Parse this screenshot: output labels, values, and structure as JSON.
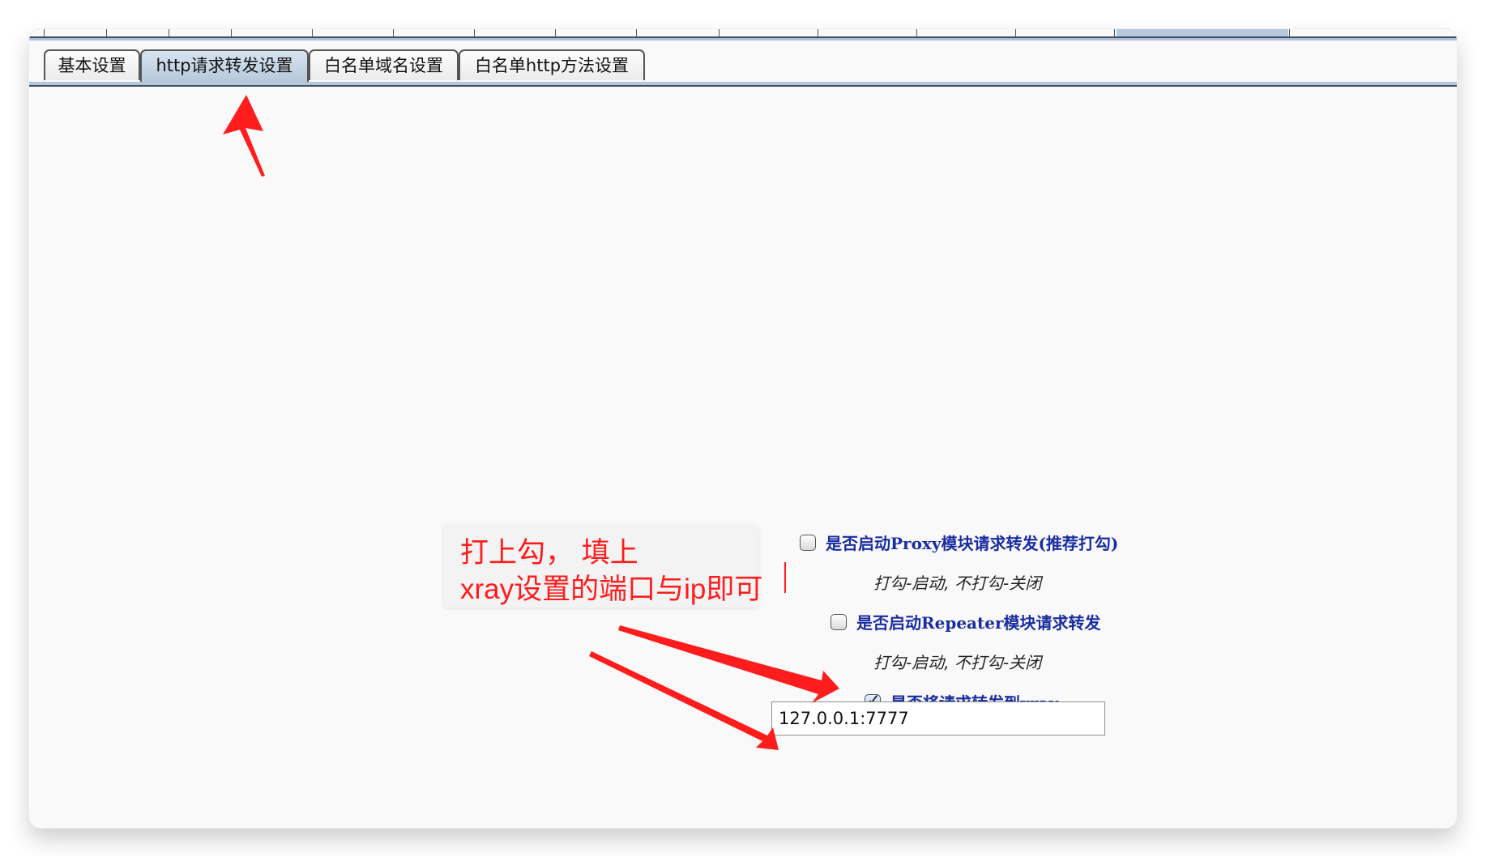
{
  "tabs": [
    {
      "label": "基本设置",
      "active": false
    },
    {
      "label": "http请求转发设置",
      "active": true
    },
    {
      "label": "白名单域名设置",
      "active": false
    },
    {
      "label": "白名单http方法设置",
      "active": false
    }
  ],
  "options": {
    "proxy": {
      "label": "是否启动Proxy模块请求转发(推荐打勾)",
      "checked": false,
      "hint": "打勾-启动, 不打勾-关闭"
    },
    "repeater": {
      "label": "是否启动Repeater模块请求转发",
      "checked": false,
      "hint": "打勾-启动, 不打勾-关闭"
    },
    "xray": {
      "label": "是否将请求转发到xray",
      "checked": true,
      "check_glyph": "✓"
    }
  },
  "proxy_address": {
    "value": "127.0.0.1:7777"
  },
  "annotation": {
    "line1": "打上勾， 填上",
    "line2": "xray设置的端口与ip即可",
    "color": "#ff1c1c"
  },
  "colors": {
    "accent": "#1a2da0",
    "tab_active": "#b5c7da",
    "border_dark": "#3b4e66"
  }
}
